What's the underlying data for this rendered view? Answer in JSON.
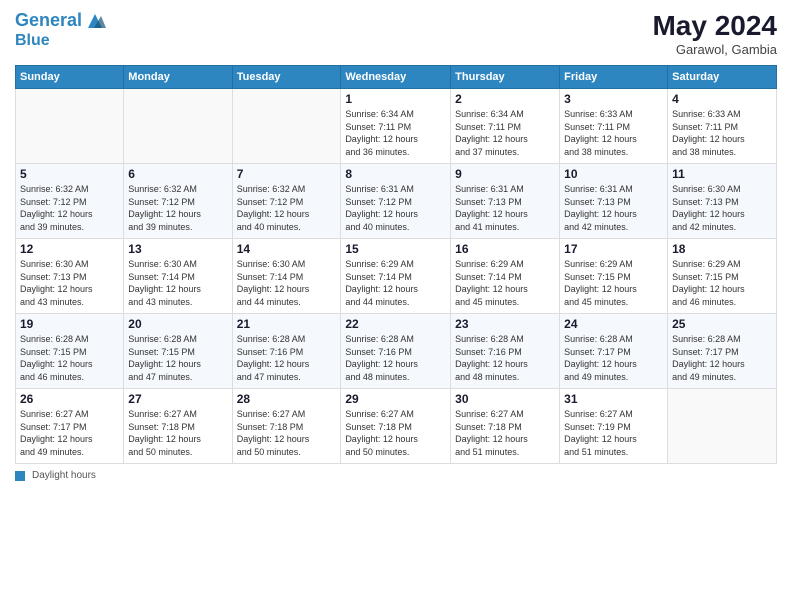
{
  "header": {
    "logo_line1": "General",
    "logo_line2": "Blue",
    "month_year": "May 2024",
    "location": "Garawol, Gambia"
  },
  "weekdays": [
    "Sunday",
    "Monday",
    "Tuesday",
    "Wednesday",
    "Thursday",
    "Friday",
    "Saturday"
  ],
  "weeks": [
    [
      {
        "day": "",
        "info": ""
      },
      {
        "day": "",
        "info": ""
      },
      {
        "day": "",
        "info": ""
      },
      {
        "day": "1",
        "info": "Sunrise: 6:34 AM\nSunset: 7:11 PM\nDaylight: 12 hours\nand 36 minutes."
      },
      {
        "day": "2",
        "info": "Sunrise: 6:34 AM\nSunset: 7:11 PM\nDaylight: 12 hours\nand 37 minutes."
      },
      {
        "day": "3",
        "info": "Sunrise: 6:33 AM\nSunset: 7:11 PM\nDaylight: 12 hours\nand 38 minutes."
      },
      {
        "day": "4",
        "info": "Sunrise: 6:33 AM\nSunset: 7:11 PM\nDaylight: 12 hours\nand 38 minutes."
      }
    ],
    [
      {
        "day": "5",
        "info": "Sunrise: 6:32 AM\nSunset: 7:12 PM\nDaylight: 12 hours\nand 39 minutes."
      },
      {
        "day": "6",
        "info": "Sunrise: 6:32 AM\nSunset: 7:12 PM\nDaylight: 12 hours\nand 39 minutes."
      },
      {
        "day": "7",
        "info": "Sunrise: 6:32 AM\nSunset: 7:12 PM\nDaylight: 12 hours\nand 40 minutes."
      },
      {
        "day": "8",
        "info": "Sunrise: 6:31 AM\nSunset: 7:12 PM\nDaylight: 12 hours\nand 40 minutes."
      },
      {
        "day": "9",
        "info": "Sunrise: 6:31 AM\nSunset: 7:13 PM\nDaylight: 12 hours\nand 41 minutes."
      },
      {
        "day": "10",
        "info": "Sunrise: 6:31 AM\nSunset: 7:13 PM\nDaylight: 12 hours\nand 42 minutes."
      },
      {
        "day": "11",
        "info": "Sunrise: 6:30 AM\nSunset: 7:13 PM\nDaylight: 12 hours\nand 42 minutes."
      }
    ],
    [
      {
        "day": "12",
        "info": "Sunrise: 6:30 AM\nSunset: 7:13 PM\nDaylight: 12 hours\nand 43 minutes."
      },
      {
        "day": "13",
        "info": "Sunrise: 6:30 AM\nSunset: 7:14 PM\nDaylight: 12 hours\nand 43 minutes."
      },
      {
        "day": "14",
        "info": "Sunrise: 6:30 AM\nSunset: 7:14 PM\nDaylight: 12 hours\nand 44 minutes."
      },
      {
        "day": "15",
        "info": "Sunrise: 6:29 AM\nSunset: 7:14 PM\nDaylight: 12 hours\nand 44 minutes."
      },
      {
        "day": "16",
        "info": "Sunrise: 6:29 AM\nSunset: 7:14 PM\nDaylight: 12 hours\nand 45 minutes."
      },
      {
        "day": "17",
        "info": "Sunrise: 6:29 AM\nSunset: 7:15 PM\nDaylight: 12 hours\nand 45 minutes."
      },
      {
        "day": "18",
        "info": "Sunrise: 6:29 AM\nSunset: 7:15 PM\nDaylight: 12 hours\nand 46 minutes."
      }
    ],
    [
      {
        "day": "19",
        "info": "Sunrise: 6:28 AM\nSunset: 7:15 PM\nDaylight: 12 hours\nand 46 minutes."
      },
      {
        "day": "20",
        "info": "Sunrise: 6:28 AM\nSunset: 7:15 PM\nDaylight: 12 hours\nand 47 minutes."
      },
      {
        "day": "21",
        "info": "Sunrise: 6:28 AM\nSunset: 7:16 PM\nDaylight: 12 hours\nand 47 minutes."
      },
      {
        "day": "22",
        "info": "Sunrise: 6:28 AM\nSunset: 7:16 PM\nDaylight: 12 hours\nand 48 minutes."
      },
      {
        "day": "23",
        "info": "Sunrise: 6:28 AM\nSunset: 7:16 PM\nDaylight: 12 hours\nand 48 minutes."
      },
      {
        "day": "24",
        "info": "Sunrise: 6:28 AM\nSunset: 7:17 PM\nDaylight: 12 hours\nand 49 minutes."
      },
      {
        "day": "25",
        "info": "Sunrise: 6:28 AM\nSunset: 7:17 PM\nDaylight: 12 hours\nand 49 minutes."
      }
    ],
    [
      {
        "day": "26",
        "info": "Sunrise: 6:27 AM\nSunset: 7:17 PM\nDaylight: 12 hours\nand 49 minutes."
      },
      {
        "day": "27",
        "info": "Sunrise: 6:27 AM\nSunset: 7:18 PM\nDaylight: 12 hours\nand 50 minutes."
      },
      {
        "day": "28",
        "info": "Sunrise: 6:27 AM\nSunset: 7:18 PM\nDaylight: 12 hours\nand 50 minutes."
      },
      {
        "day": "29",
        "info": "Sunrise: 6:27 AM\nSunset: 7:18 PM\nDaylight: 12 hours\nand 50 minutes."
      },
      {
        "day": "30",
        "info": "Sunrise: 6:27 AM\nSunset: 7:18 PM\nDaylight: 12 hours\nand 51 minutes."
      },
      {
        "day": "31",
        "info": "Sunrise: 6:27 AM\nSunset: 7:19 PM\nDaylight: 12 hours\nand 51 minutes."
      },
      {
        "day": "",
        "info": ""
      }
    ]
  ],
  "footer": {
    "label": "Daylight hours"
  }
}
